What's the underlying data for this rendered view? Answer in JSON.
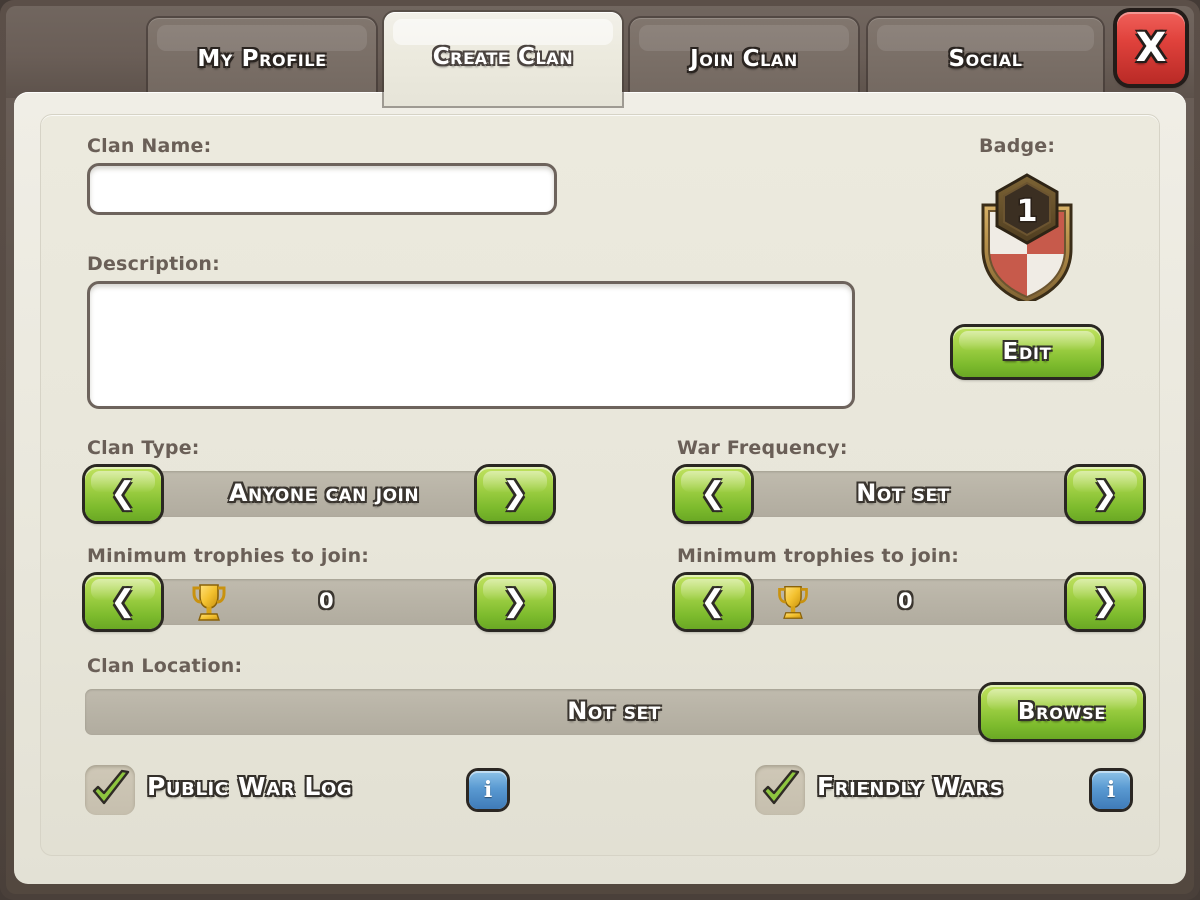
{
  "window": {
    "close_label": "X"
  },
  "tabs": [
    {
      "label": "My Profile",
      "active": false
    },
    {
      "label": "Create Clan",
      "active": true
    },
    {
      "label": "Join Clan",
      "active": false
    },
    {
      "label": "Social",
      "active": false
    }
  ],
  "form": {
    "clan_name": {
      "label": "Clan Name:",
      "value": "",
      "placeholder": ""
    },
    "description": {
      "label": "Description:",
      "value": "",
      "placeholder": ""
    },
    "badge": {
      "label": "Badge:",
      "level": "1",
      "edit_label": "Edit",
      "colors": {
        "border": "#9a7c46",
        "red": "#c75a4b",
        "white": "#f2efe9",
        "hex_dark": "#3b2f22"
      }
    },
    "clan_type": {
      "label": "Clan Type:",
      "value": "Anyone can join",
      "prev_label": "❮",
      "next_label": "❯"
    },
    "war_frequency": {
      "label": "War Frequency:",
      "value": "Not set",
      "prev_label": "❮",
      "next_label": "❯"
    },
    "min_trophies_left": {
      "label": "Minimum trophies to join:",
      "value": "0",
      "icon": "trophy-icon",
      "prev_label": "❮",
      "next_label": "❯"
    },
    "min_trophies_right": {
      "label": "Minimum trophies to join:",
      "value": "0",
      "icon": "trophy-icon",
      "prev_label": "❮",
      "next_label": "❯"
    },
    "clan_location": {
      "label": "Clan Location:",
      "value": "Not set",
      "browse_label": "Browse"
    },
    "public_war_log": {
      "label": "Public War Log",
      "checked": true,
      "info_label": "i"
    },
    "friendly_wars": {
      "label": "Friendly Wars",
      "checked": true,
      "info_label": "i"
    }
  },
  "theme": {
    "frame": "#574b44",
    "panel": "#eae8dd",
    "green": "#8cc63f",
    "red": "#d5332e",
    "blue": "#5a9ad2",
    "label_text": "#6a5f57"
  }
}
